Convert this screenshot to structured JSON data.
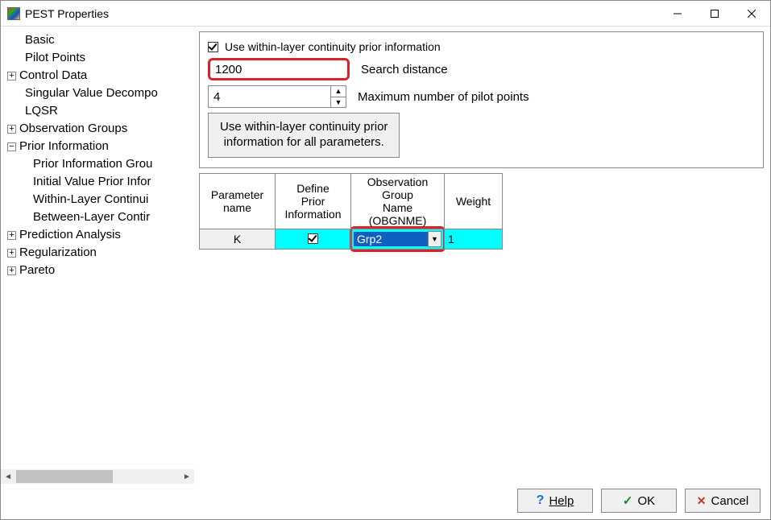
{
  "window": {
    "title": "PEST Properties"
  },
  "tree": {
    "items": [
      {
        "label": "Basic",
        "exp": null,
        "child": false
      },
      {
        "label": "Pilot Points",
        "exp": null,
        "child": false
      },
      {
        "label": "Control Data",
        "exp": "+",
        "child": false
      },
      {
        "label": "Singular Value Decompo",
        "exp": null,
        "child": false
      },
      {
        "label": "LQSR",
        "exp": null,
        "child": false
      },
      {
        "label": "Observation Groups",
        "exp": "+",
        "child": false
      },
      {
        "label": "Prior Information",
        "exp": "−",
        "child": false
      },
      {
        "label": "Prior Information Grou",
        "exp": null,
        "child": true
      },
      {
        "label": "Initial Value Prior Infor",
        "exp": null,
        "child": true
      },
      {
        "label": "Within-Layer Continui",
        "exp": null,
        "child": true
      },
      {
        "label": "Between-Layer Contir",
        "exp": null,
        "child": true
      },
      {
        "label": "Prediction Analysis",
        "exp": "+",
        "child": false
      },
      {
        "label": "Regularization",
        "exp": "+",
        "child": false
      },
      {
        "label": "Pareto",
        "exp": "+",
        "child": false
      }
    ]
  },
  "panel": {
    "chk_label": "Use within-layer continuity prior information",
    "chk_checked": true,
    "search_value": "1200",
    "search_label": "Search distance",
    "maxpp_value": "4",
    "maxpp_label": "Maximum number of pilot points",
    "apply_btn_l1": "Use within-layer continuity prior",
    "apply_btn_l2": "information for all parameters."
  },
  "grid": {
    "headers": {
      "c1a": "Parameter",
      "c1b": "name",
      "c2a": "Define",
      "c2b": "Prior",
      "c2c": "Information",
      "c3a": "Observation",
      "c3b": "Group",
      "c3c": "Name",
      "c3d": "(OBGNME)",
      "c4": "Weight"
    },
    "row": {
      "param": "K",
      "define_checked": true,
      "obgnme": "Grp2",
      "weight": "1"
    }
  },
  "footer": {
    "help": "Help",
    "ok": "OK",
    "cancel": "Cancel"
  }
}
